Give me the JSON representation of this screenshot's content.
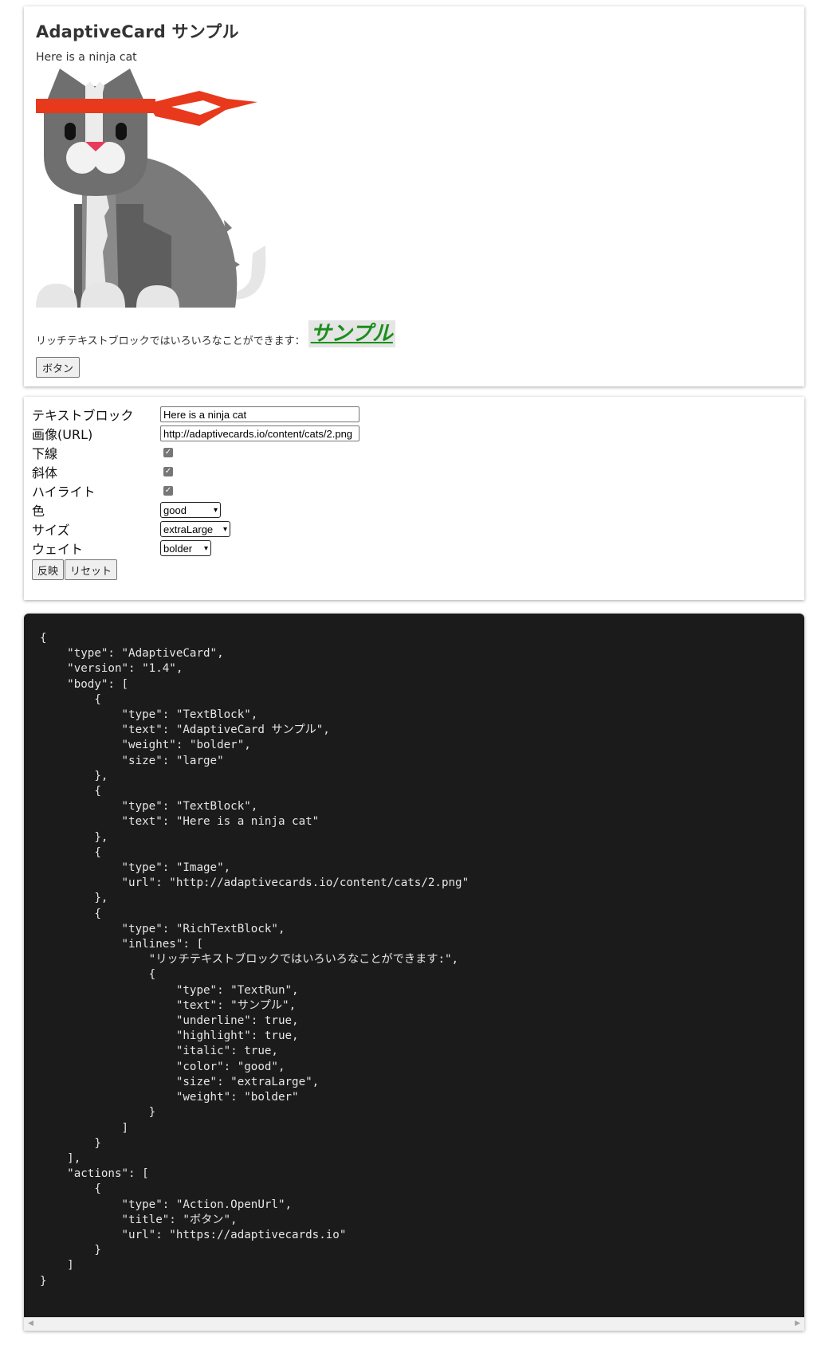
{
  "card": {
    "title": "AdaptiveCard サンプル",
    "subtitle": "Here is a ninja cat",
    "rich_text_prefix": "リッチテキストブロックではいろいろなことができます：",
    "rich_text_run": "サンプル",
    "button_label": "ボタン"
  },
  "form": {
    "fields": [
      {
        "label": "テキストブロック",
        "value": "Here is a ninja cat"
      },
      {
        "label": "画像(URL)",
        "value": "http://adaptivecards.io/content/cats/2.png"
      },
      {
        "label": "下線",
        "checked": true
      },
      {
        "label": "斜体",
        "checked": true
      },
      {
        "label": "ハイライト",
        "checked": true
      },
      {
        "label": "色",
        "selected": "good"
      },
      {
        "label": "サイズ",
        "selected": "extraLarge"
      },
      {
        "label": "ウェイト",
        "selected": "bolder"
      }
    ],
    "apply_label": "反映",
    "reset_label": "リセット"
  },
  "code": {
    "json_text": "{\n    \"type\": \"AdaptiveCard\",\n    \"version\": \"1.4\",\n    \"body\": [\n        {\n            \"type\": \"TextBlock\",\n            \"text\": \"AdaptiveCard サンプル\",\n            \"weight\": \"bolder\",\n            \"size\": \"large\"\n        },\n        {\n            \"type\": \"TextBlock\",\n            \"text\": \"Here is a ninja cat\"\n        },\n        {\n            \"type\": \"Image\",\n            \"url\": \"http://adaptivecards.io/content/cats/2.png\"\n        },\n        {\n            \"type\": \"RichTextBlock\",\n            \"inlines\": [\n                \"リッチテキストブロックではいろいろなことができます:\",\n                {\n                    \"type\": \"TextRun\",\n                    \"text\": \"サンプル\",\n                    \"underline\": true,\n                    \"highlight\": true,\n                    \"italic\": true,\n                    \"color\": \"good\",\n                    \"size\": \"extraLarge\",\n                    \"weight\": \"bolder\"\n                }\n            ]\n        }\n    ],\n    \"actions\": [\n        {\n            \"type\": \"Action.OpenUrl\",\n            \"title\": \"ボタン\",\n            \"url\": \"https://adaptivecards.io\"\n        }\n    ]\n}"
  },
  "colors": {
    "good": "#1b8f1b",
    "highlight": "#e5e5e5",
    "code_bg": "#1b1b1b",
    "headband": "#e8391d",
    "cat_gray": "#6f6f6f"
  }
}
